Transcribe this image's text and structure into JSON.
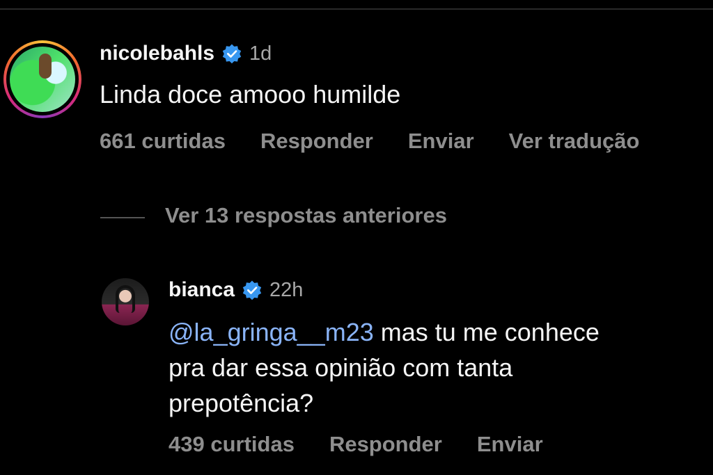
{
  "comment": {
    "username": "nicolebahls",
    "time": "1d",
    "text": "Linda doce amooo humilde",
    "likes": "661 curtidas",
    "reply_label": "Responder",
    "send_label": "Enviar",
    "translate_label": "Ver tradução"
  },
  "replies_toggle": "Ver 13 respostas anteriores",
  "reply": {
    "username": "bianca",
    "time": "22h",
    "mention": "@la_gringa__m23",
    "line1_rest": " mas tu me conhece",
    "line2": "pra dar essa opinião com tanta",
    "line3": "prepotência?",
    "likes": "439 curtidas",
    "reply_label": "Responder",
    "send_label": "Enviar"
  },
  "colors": {
    "background": "#000000",
    "verified": "#3897f0",
    "muted": "#8e8e8e",
    "mention": "#8ab4f8"
  }
}
